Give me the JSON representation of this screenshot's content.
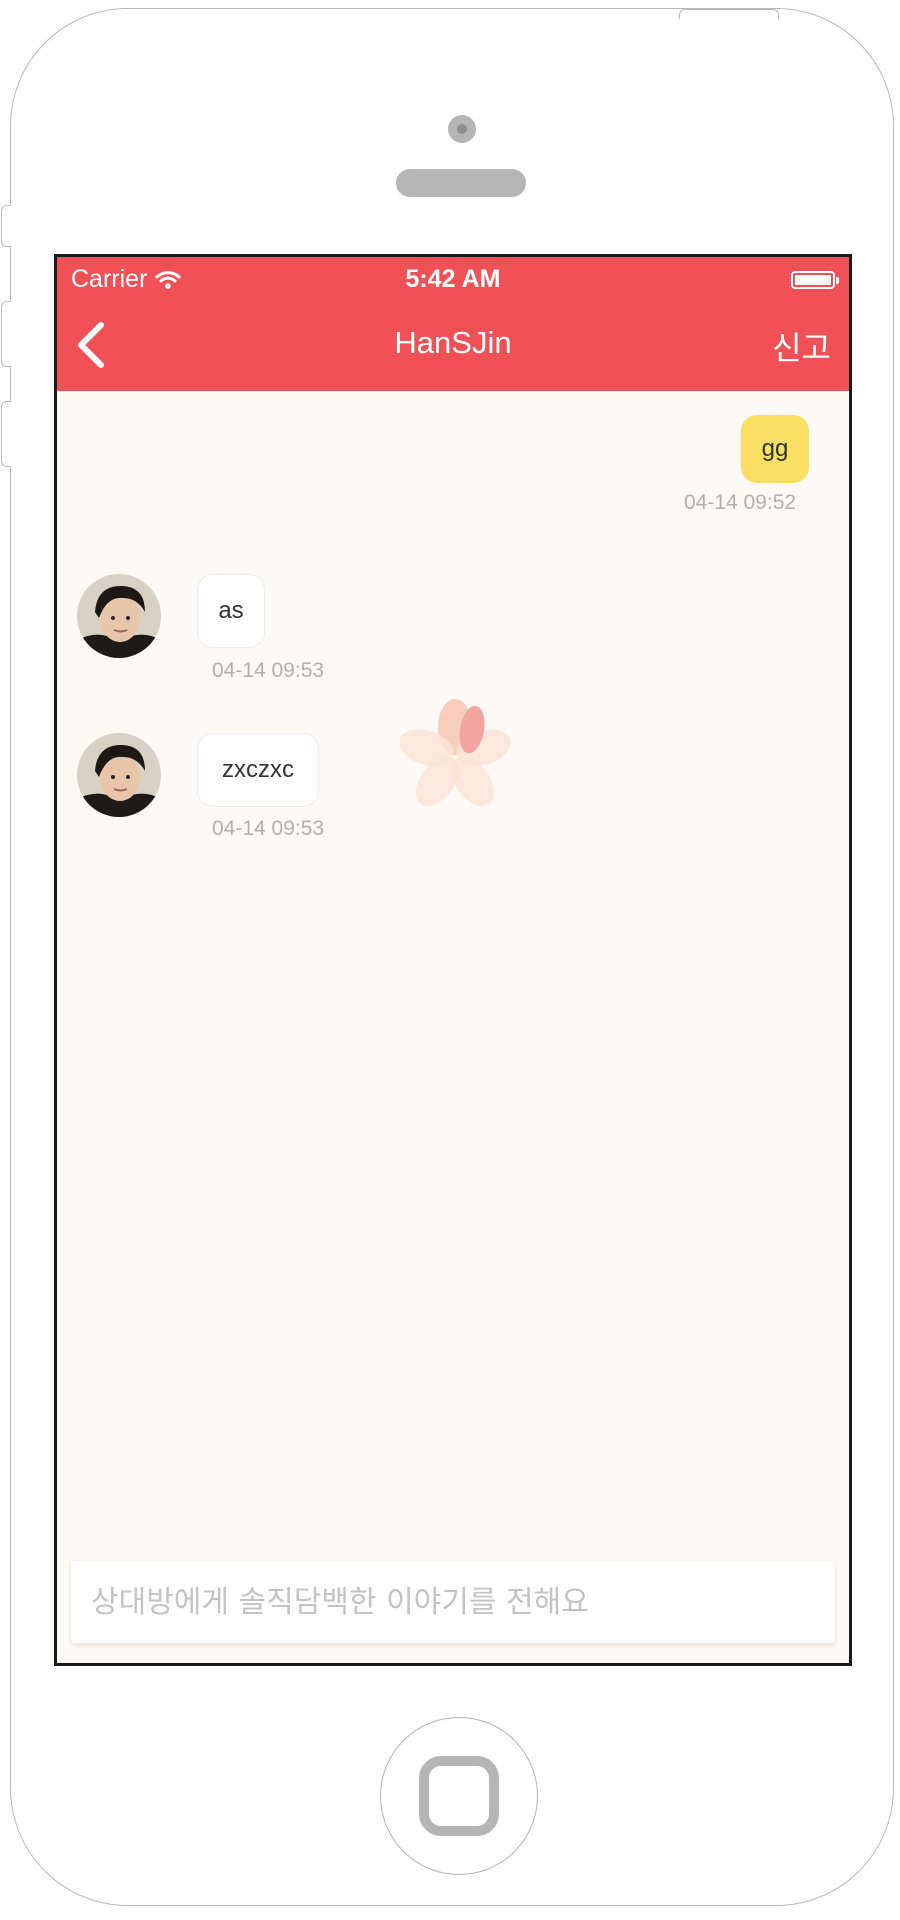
{
  "status_bar": {
    "carrier": "Carrier",
    "time": "5:42 AM",
    "wifi_icon": "wifi-icon",
    "battery_icon": "battery-icon"
  },
  "nav": {
    "back_icon": "chevron-left-icon",
    "title": "HanSJin",
    "report_label": "신고"
  },
  "messages": [
    {
      "from": "me",
      "text": "gg",
      "time": "04-14 09:52"
    },
    {
      "from": "other",
      "text": "as",
      "time": "04-14 09:53"
    },
    {
      "from": "other",
      "text": "zxczxc",
      "time": "04-14 09:53"
    }
  ],
  "input": {
    "placeholder": "상대방에게 솔직담백한 이야기를 전해요",
    "value": ""
  },
  "colors": {
    "header": "#f05156",
    "background": "#fdfaf5",
    "my_bubble": "#f9df62",
    "other_bubble": "#ffffff",
    "timestamp": "#b3b0ab"
  }
}
